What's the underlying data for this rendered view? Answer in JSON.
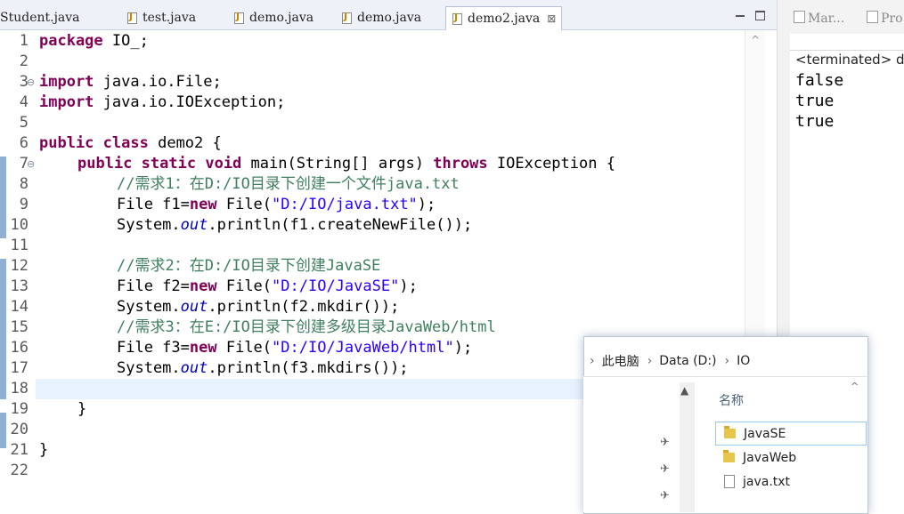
{
  "tabs": [
    {
      "label": "Student.java",
      "active": false
    },
    {
      "label": "test.java",
      "active": false
    },
    {
      "label": "demo.java",
      "active": false
    },
    {
      "label": "demo.java",
      "active": false
    },
    {
      "label": "demo2.java",
      "active": true
    }
  ],
  "tab_close_glyph": "⊠",
  "line_numbers": [
    "1",
    "2",
    "3",
    "4",
    "5",
    "6",
    "7",
    "8",
    "9",
    "10",
    "11",
    "12",
    "13",
    "14",
    "15",
    "16",
    "17",
    "18",
    "19",
    "20",
    "21",
    "22"
  ],
  "code": {
    "l1": {
      "kw": "package",
      "rest": " IO_;"
    },
    "l3": {
      "kw": "import",
      "rest": " java.io.File;"
    },
    "l4": {
      "kw": "import",
      "rest": " java.io.IOException;"
    },
    "l6": {
      "kw1": "public",
      "sp": " ",
      "kw2": "class",
      "rest": " demo2 {"
    },
    "l7": {
      "kw1": "public",
      "kw2": "static",
      "kw3": "void",
      "mid": " main(String[] args) ",
      "kw4": "throws",
      "rest": " IOException {"
    },
    "l8": {
      "comment": "//需求1：在D:/IO目录下创建一个文件java.txt"
    },
    "l9": {
      "a": "File f1=",
      "kw": "new",
      "b": " File(",
      "str": "\"D:/IO/java.txt\"",
      "c": ");"
    },
    "l10": {
      "a": "System.",
      "field": "out",
      "b": ".println(f1.createNewFile());"
    },
    "l12": {
      "comment": "//需求2：在D:/IO目录下创建JavaSE"
    },
    "l13": {
      "a": "File f2=",
      "kw": "new",
      "b": " File(",
      "str": "\"D:/IO/JavaSE\"",
      "c": ");"
    },
    "l14": {
      "a": "System.",
      "field": "out",
      "b": ".println(f2.mkdir());"
    },
    "l15": {
      "comment": "//需求3：在E:/IO目录下创建多级目录JavaWeb/html"
    },
    "l16": {
      "a": "File f3=",
      "kw": "new",
      "b": " File(",
      "str": "\"D:/IO/JavaWeb/html\"",
      "c": ");"
    },
    "l17": {
      "a": "System.",
      "field": "out",
      "b": ".println(f3.mkdirs());"
    },
    "l19": {
      "text": "}"
    },
    "l21": {
      "text": "}"
    }
  },
  "console": {
    "tabs": [
      {
        "label": "Mar..."
      },
      {
        "label": "Pro"
      }
    ],
    "terminated": "<terminated> de",
    "output": [
      "false",
      "true",
      "true"
    ]
  },
  "explorer": {
    "breadcrumb": [
      "此电脑",
      "Data (D:)",
      "IO"
    ],
    "column_header": "名称",
    "files": [
      {
        "name": "JavaSE",
        "type": "folder"
      },
      {
        "name": "JavaWeb",
        "type": "folder"
      },
      {
        "name": "java.txt",
        "type": "file"
      }
    ]
  },
  "colors": {
    "keyword": "#7f0055",
    "comment": "#3f7f5f",
    "string": "#2a00ff",
    "field": "#0000c0"
  }
}
